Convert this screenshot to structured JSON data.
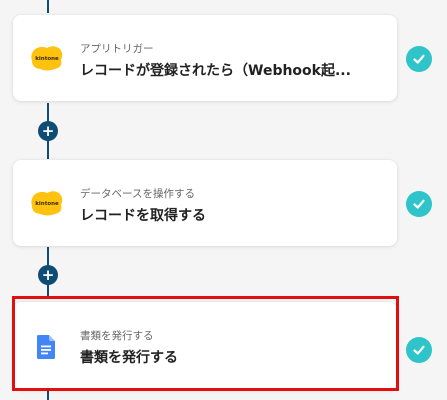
{
  "steps": [
    {
      "type_label": "アプリトリガー",
      "title": "レコードが登録されたら（Webhook起...",
      "icon": "kintone-icon",
      "icon_text": "kintone",
      "status": "complete"
    },
    {
      "type_label": "データベースを操作する",
      "title": "レコードを取得する",
      "icon": "kintone-icon",
      "icon_text": "kintone",
      "status": "complete"
    },
    {
      "type_label": "書類を発行する",
      "title": "書類を発行する",
      "icon": "google-docs-icon",
      "status": "complete",
      "highlighted": true
    }
  ],
  "add_step_symbol": "+",
  "colors": {
    "connector": "#0f4c75",
    "check": "#2ec4c9",
    "highlight": "#e10f0f",
    "kintone": "#ffc20e",
    "docs": "#4285f4"
  }
}
